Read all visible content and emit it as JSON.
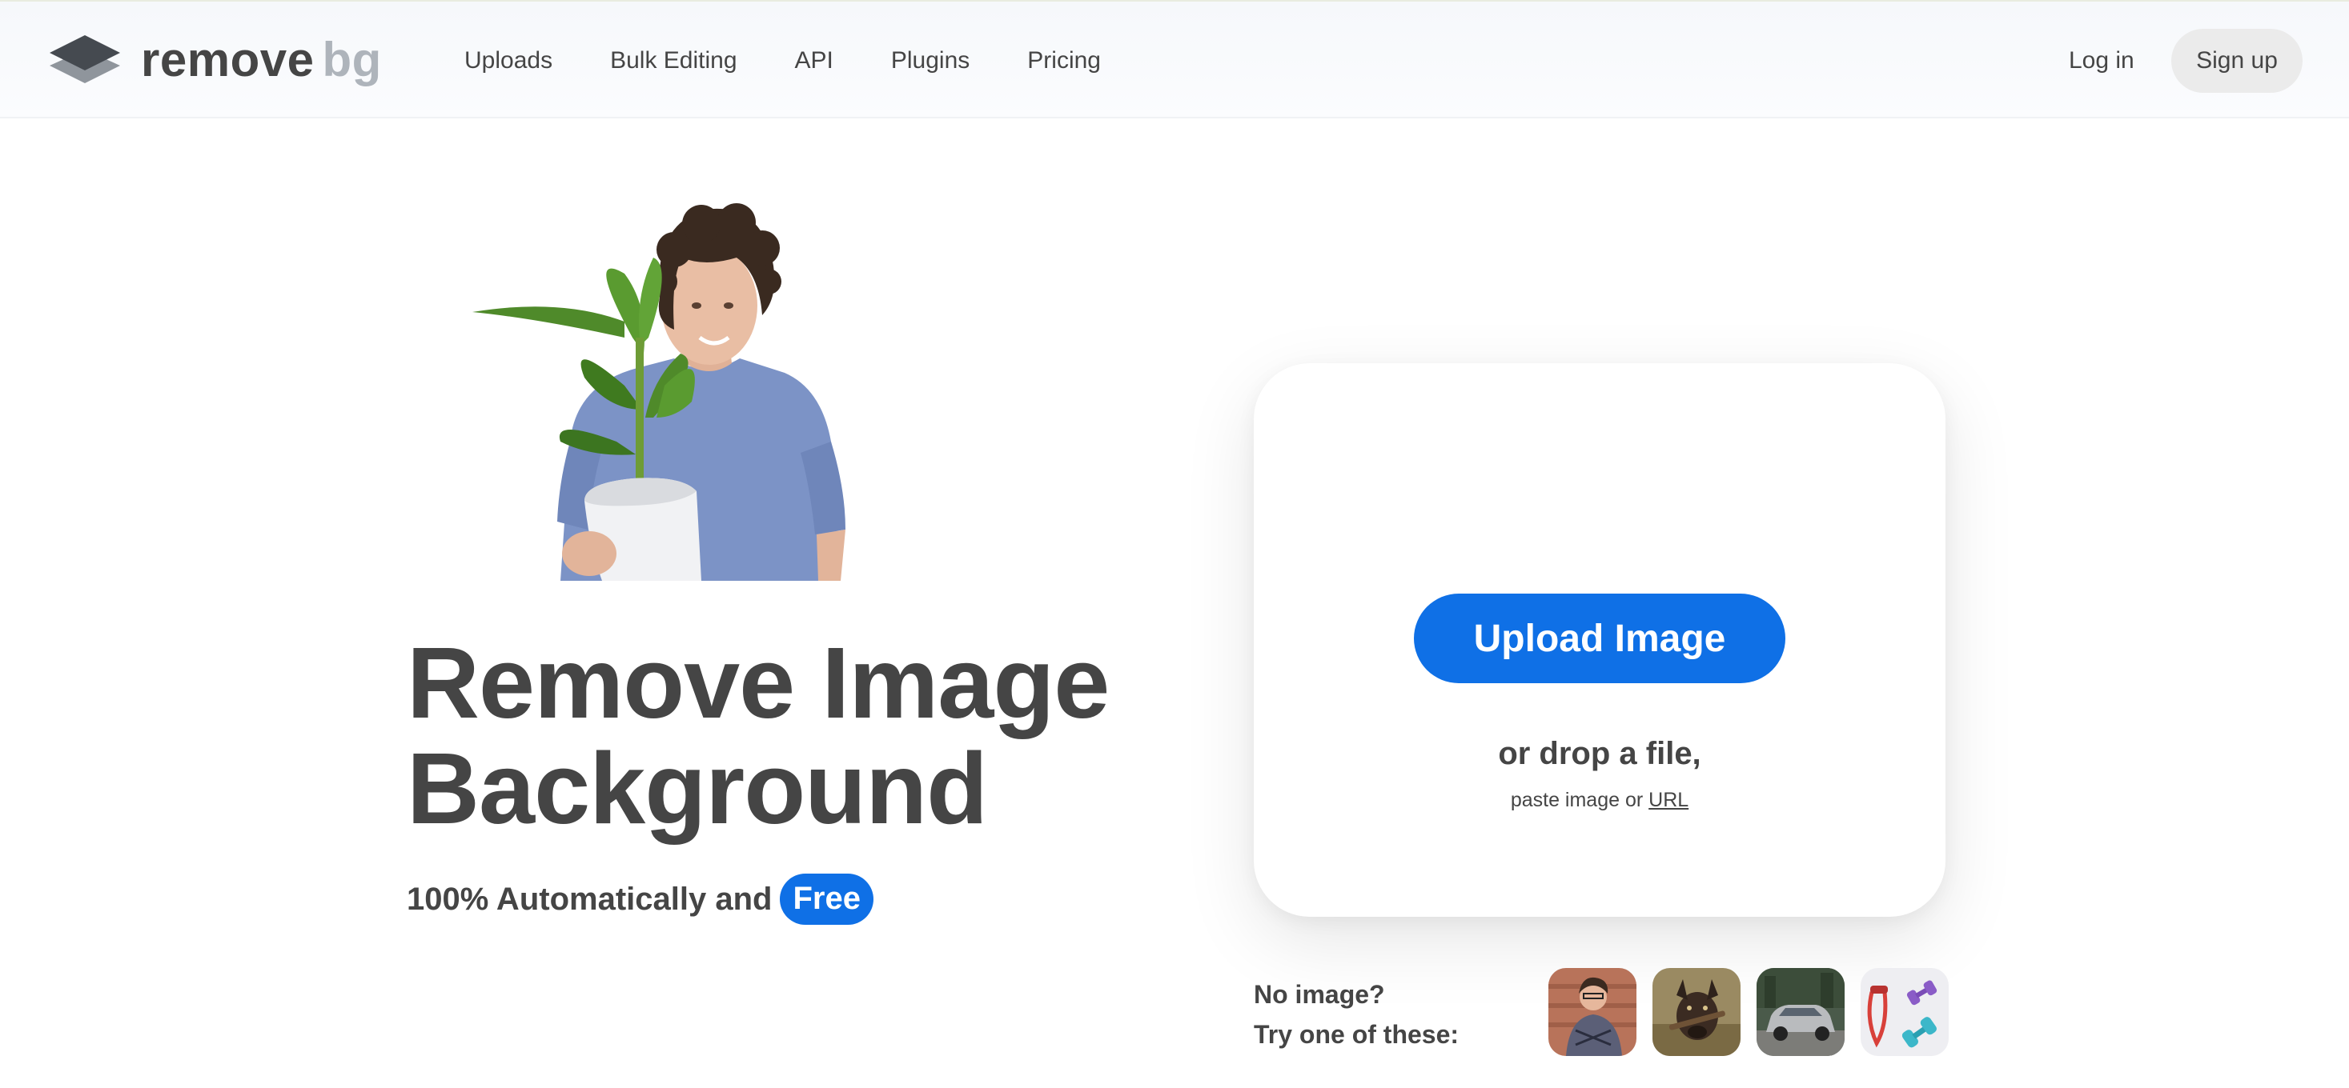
{
  "header": {
    "logo": {
      "word1": "remove",
      "word2": "bg"
    },
    "nav": [
      "Uploads",
      "Bulk Editing",
      "API",
      "Plugins",
      "Pricing"
    ],
    "login": "Log in",
    "signup": "Sign up"
  },
  "hero": {
    "title_line1": "Remove Image",
    "title_line2": "Background",
    "subtitle": "100% Automatically and",
    "badge": "Free"
  },
  "upload": {
    "button": "Upload Image",
    "drop_text": "or drop a file,",
    "paste_text": "paste image or",
    "url_link": "URL"
  },
  "samples": {
    "line1": "No image?",
    "line2": "Try one of these:"
  },
  "colors": {
    "accent": "#0f70e6",
    "text": "#454545",
    "logo_bg": "#aeb4bb",
    "signup_bg": "#ebebeb"
  }
}
